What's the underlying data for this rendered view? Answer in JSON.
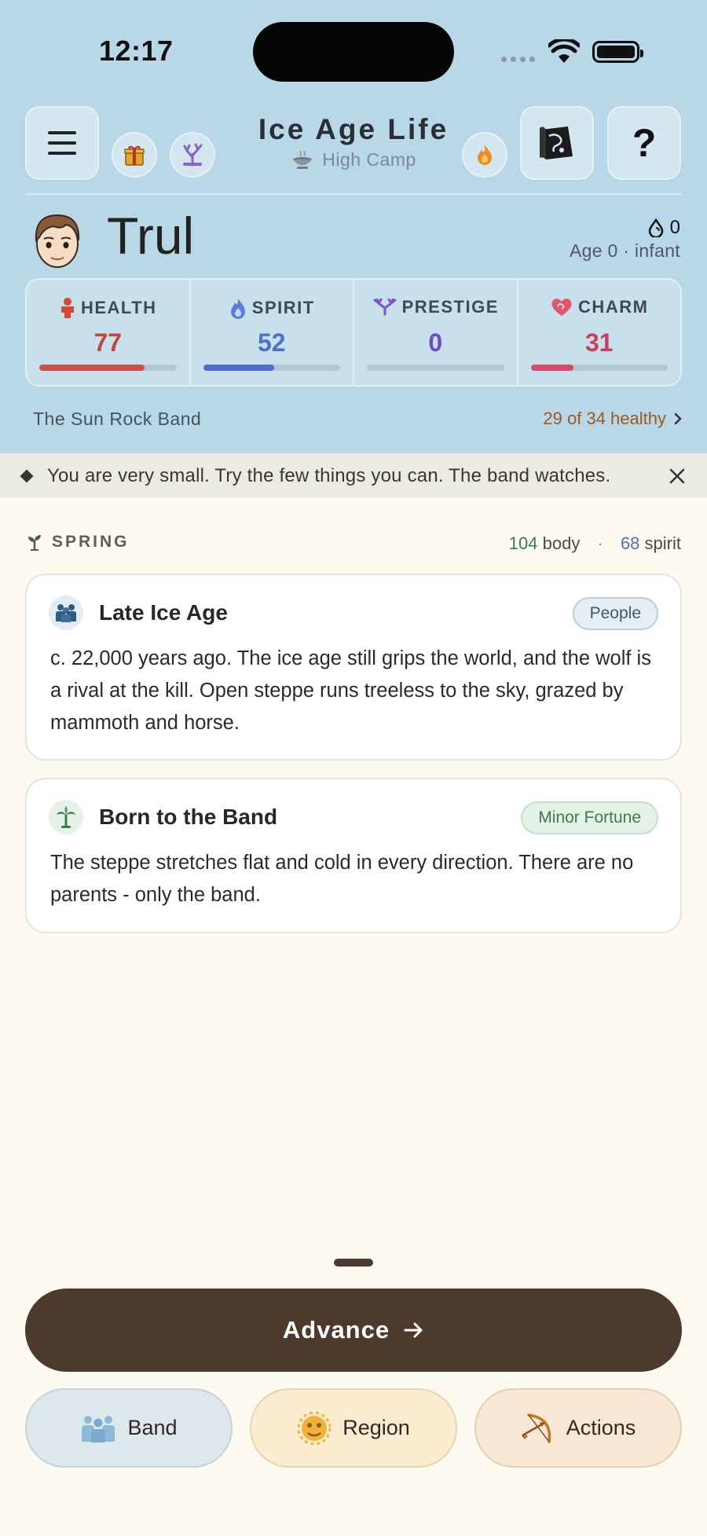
{
  "status_bar": {
    "time": "12:17"
  },
  "header": {
    "title": "Ice Age Life",
    "subtitle": "High Camp",
    "icons": [
      "menu-icon",
      "gift-icon",
      "coral-icon",
      "fire-icon",
      "scroll-map-icon",
      "help-icon"
    ],
    "help_glyph": "?"
  },
  "character": {
    "name": "Trul",
    "coins": "0",
    "age_text": "Age 0 · infant"
  },
  "stats": [
    {
      "label": "HEALTH",
      "value": "77",
      "fill": 0.77,
      "color": "#c0483a",
      "bar_color": "#c9514a"
    },
    {
      "label": "SPIRIT",
      "value": "52",
      "fill": 0.52,
      "color": "#4f72c8",
      "bar_color": "#4d6fcb"
    },
    {
      "label": "PRESTIGE",
      "value": "0",
      "fill": 0.0,
      "color": "#6b4fc0",
      "bar_color": "#6b4fc0"
    },
    {
      "label": "CHARM",
      "value": "31",
      "fill": 0.31,
      "color": "#c8405e",
      "bar_color": "#d64a6a"
    }
  ],
  "band": {
    "name": "The Sun Rock Band",
    "health_text": "29 of 34 healthy"
  },
  "notice": {
    "text": "You are very small. Try the few things you can. The band watches."
  },
  "season": {
    "label": "SPRING",
    "body_value": "104",
    "body_label": "body",
    "separator": "·",
    "spirit_value": "68",
    "spirit_label": "spirit"
  },
  "cards": [
    {
      "title": "Late Ice Age",
      "tag": "People",
      "icon": "people-icon",
      "text": "c. 22,000 years ago. The ice age still grips the world, and the wolf is a rival at the kill. Open steppe runs treeless to the sky, grazed by mammoth and horse."
    },
    {
      "title": "Born to the Band",
      "tag": "Minor Fortune",
      "icon": "palm-icon",
      "text": "The steppe stretches flat and cold in every direction. There are no parents - only the band."
    }
  ],
  "actions": {
    "advance_label": "Advance",
    "tabs": [
      "Band",
      "Region",
      "Actions"
    ]
  }
}
